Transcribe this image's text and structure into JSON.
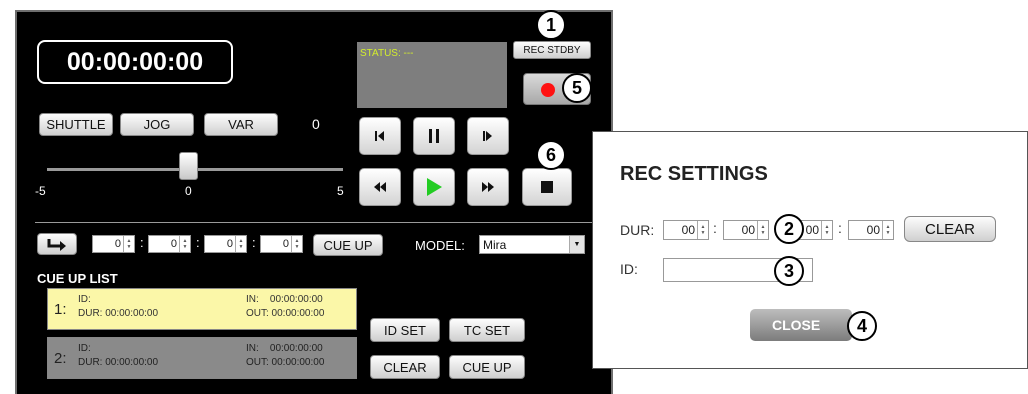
{
  "deck": {
    "timecode": "00:00:00:00",
    "status_text": "STATUS: ---",
    "rec_stby_label": "REC STDBY",
    "shuttle_label": "SHUTTLE",
    "jog_label": "JOG",
    "var_label": "VAR",
    "var_value": "0",
    "slider_min": "-5",
    "slider_mid": "0",
    "slider_max": "5",
    "slider_level": 0
  },
  "cue": {
    "fields": [
      "0",
      "0",
      "0",
      "0"
    ],
    "cue_up_label": "CUE UP",
    "model_label": "MODEL:",
    "model_value": "Mira",
    "list_title": "CUE UP LIST",
    "items": [
      {
        "num": "1:",
        "id_label": "ID:",
        "dur": "DUR: 00:00:00:00",
        "in": "IN:    00:00:00:00",
        "out": "OUT: 00:00:00:00",
        "color": "#fbf7a8"
      },
      {
        "num": "2:",
        "id_label": "ID:",
        "dur": "DUR: 00:00:00:00",
        "in": "IN:    00:00:00:00",
        "out": "OUT: 00:00:00:00",
        "color": "#8a8a8a"
      }
    ],
    "id_set_label": "ID SET",
    "tc_set_label": "TC SET",
    "clear_label": "CLEAR",
    "cue_up2_label": "CUE UP"
  },
  "rec_settings": {
    "title": "REC SETTINGS",
    "dur_label": "DUR:",
    "dur_fields": [
      "00",
      "00",
      "00",
      "00"
    ],
    "clear_label": "CLEAR",
    "id_label": "ID:",
    "id_value": "",
    "close_label": "CLOSE"
  },
  "callouts": [
    "1",
    "2",
    "3",
    "4",
    "5",
    "6"
  ],
  "colors": {
    "status_text": "#d4ee2c",
    "play_green": "#22cc22",
    "rec_red": "#ff1111"
  }
}
